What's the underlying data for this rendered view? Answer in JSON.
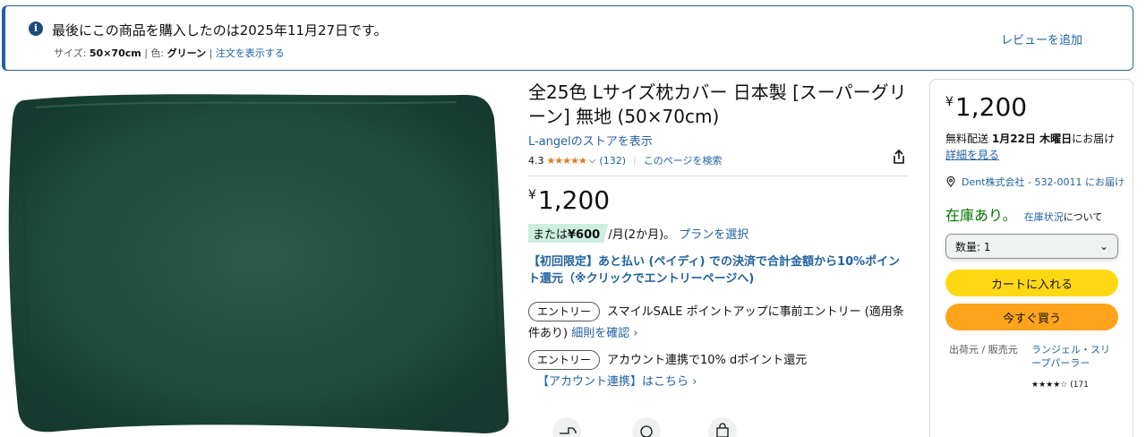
{
  "banner": {
    "message": "最後にこの商品を購入したのは2025年11月27日です。",
    "size_label": "サイズ:",
    "size_value": "50×70cm",
    "color_label": "色:",
    "color_value": "グリーン",
    "order_link": "注文を表示する",
    "review_link": "レビューを追加"
  },
  "product": {
    "title": "全25色 Lサイズ枕カバー 日本製 [スーパーグリーン] 無地 (50×70cm)",
    "store_link": "L-angelのストアを表示",
    "rating": "4.3",
    "stars": "★★★★★",
    "review_count": "(132)",
    "search_page": "このページを検索",
    "price_symbol": "¥",
    "price": "1,200",
    "installment_prefix": "または",
    "installment_amount": "¥600",
    "installment_suffix": "/月(2か月)。",
    "plan_link": "プランを選択",
    "promo": "【初回限定】あと払い (ペイディ) での決済で合計金額から10%ポイント還元（※クリックでエントリーページへ)",
    "entry_badge": "エントリー",
    "entry1_text": "スマイルSALE ポイントアップに事前エントリー (適用条件あり)",
    "entry1_link": "細則を確認 ›",
    "entry2_text": "アカウント連携で10% dポイント還元",
    "entry2_link": "【アカウント連携】はこちら ›"
  },
  "buybox": {
    "price_symbol": "¥",
    "price": "1,200",
    "delivery_prefix": "無料配送",
    "delivery_date": "1月22日 木曜日",
    "delivery_suffix": "にお届け",
    "details_link": "詳細を見る",
    "address": "Dent株式会社 - 532-0011 にお届け",
    "stock": "在庫あり。",
    "stock_link": "在庫状況",
    "stock_suffix": "について",
    "quantity_label": "数量: 1",
    "cart_button": "カートに入れる",
    "buy_button": "今すぐ買う",
    "seller_label": "出荷元 / 販売元",
    "seller_name": "ランジェル・スリープパーラー",
    "seller_stars": "★★★★☆",
    "seller_count": "(171"
  },
  "colors": {
    "link": "#2162a1",
    "cart": "#ffd814",
    "buy": "#ffa41c",
    "stars": "#de7921",
    "stock": "#007600",
    "pillow": "#1f4a3c"
  }
}
